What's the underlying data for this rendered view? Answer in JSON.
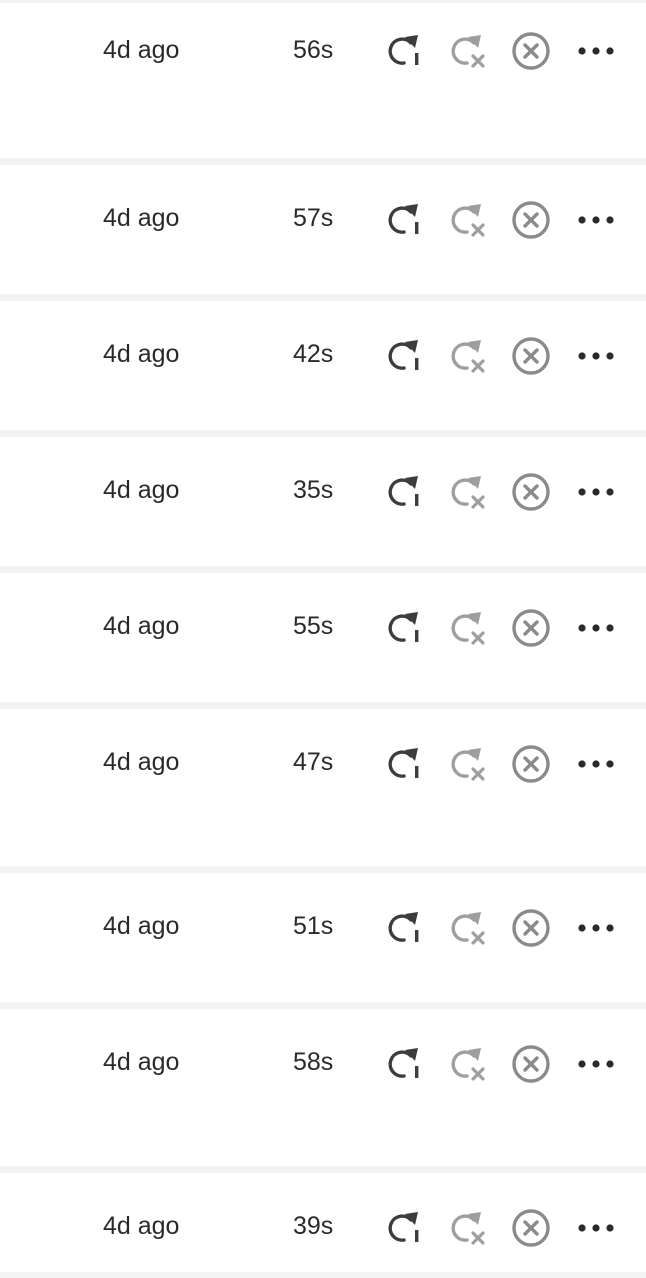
{
  "runs": [
    {
      "time": "4d ago",
      "duration": "56s"
    },
    {
      "time": "4d ago",
      "duration": "57s"
    },
    {
      "time": "4d ago",
      "duration": "42s"
    },
    {
      "time": "4d ago",
      "duration": "35s"
    },
    {
      "time": "4d ago",
      "duration": "55s"
    },
    {
      "time": "4d ago",
      "duration": "47s"
    },
    {
      "time": "4d ago",
      "duration": "51s"
    },
    {
      "time": "4d ago",
      "duration": "58s"
    },
    {
      "time": "4d ago",
      "duration": "39s"
    }
  ],
  "icons": {
    "rerun": "rerun-icon",
    "rerun_failed": "rerun-failed-icon",
    "cancel": "cancel-icon",
    "more": "more-options-icon"
  },
  "colors": {
    "active_icon": "#3c3c3c",
    "disabled_icon": "#9e9e9e",
    "cancel_icon": "#8a8a8a",
    "separator": "#f3f3f3"
  }
}
